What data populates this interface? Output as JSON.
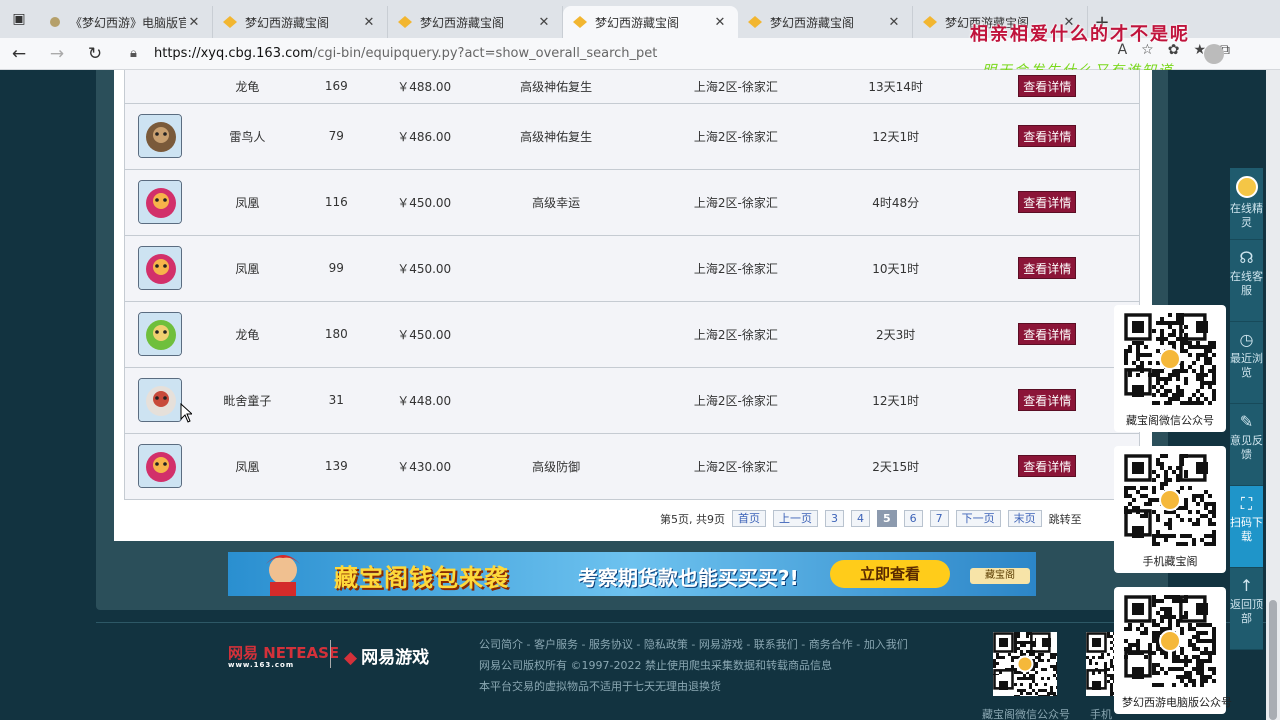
{
  "browser": {
    "tabs": [
      {
        "title": "《梦幻西游》电脑版官方",
        "active": false
      },
      {
        "title": "梦幻西游藏宝阁",
        "active": false
      },
      {
        "title": "梦幻西游藏宝阁",
        "active": false
      },
      {
        "title": "梦幻西游藏宝阁",
        "active": true
      },
      {
        "title": "梦幻西游藏宝阁",
        "active": false
      },
      {
        "title": "梦幻西游藏宝阁",
        "active": false
      }
    ],
    "url_domain": "https://xyq.cbg.163.com",
    "url_path": "/cgi-bin/equipquery.py?act=show_overall_search_pet",
    "close_glyph": "✕",
    "new_tab_glyph": "+"
  },
  "overlay": {
    "line1": "相亲相爱什么的才不是呢",
    "line2": "明天会发生什么又有谁知道"
  },
  "table": {
    "rows": [
      {
        "name": "龙龟",
        "level": "169",
        "price": "￥488.00",
        "skill": "高级神佑复生",
        "server": "上海2区-徐家汇",
        "time": "13天14时",
        "button": "查看详情"
      },
      {
        "name": "雷鸟人",
        "level": "79",
        "price": "￥486.00",
        "skill": "高级神佑复生",
        "server": "上海2区-徐家汇",
        "time": "12天1时",
        "button": "查看详情"
      },
      {
        "name": "凤凰",
        "level": "116",
        "price": "￥450.00",
        "skill": "高级幸运",
        "server": "上海2区-徐家汇",
        "time": "4时48分",
        "button": "查看详情"
      },
      {
        "name": "凤凰",
        "level": "99",
        "price": "￥450.00",
        "skill": "",
        "server": "上海2区-徐家汇",
        "time": "10天1时",
        "button": "查看详情"
      },
      {
        "name": "龙龟",
        "level": "180",
        "price": "￥450.00",
        "skill": "",
        "server": "上海2区-徐家汇",
        "time": "2天3时",
        "button": "查看详情"
      },
      {
        "name": "毗舍童子",
        "level": "31",
        "price": "￥448.00",
        "skill": "",
        "server": "上海2区-徐家汇",
        "time": "12天1时",
        "button": "查看详情"
      },
      {
        "name": "凤凰",
        "level": "139",
        "price": "￥430.00",
        "skill": "高级防御",
        "server": "上海2区-徐家汇",
        "time": "2天15时",
        "button": "查看详情"
      }
    ]
  },
  "pager": {
    "summary": "第5页, 共9页",
    "first": "首页",
    "prev": "上一页",
    "pages": [
      "3",
      "4",
      "5",
      "6",
      "7"
    ],
    "current": "5",
    "next": "下一页",
    "last": "末页",
    "jump": "跳转至"
  },
  "banner": {
    "headline": "藏宝阁钱包来袭",
    "sub": "考察期货款也能买买买?!",
    "cta": "立即查看",
    "logo": "藏宝阁"
  },
  "footer": {
    "netease_logo": "网易 NETEASE",
    "netease_url": "www.163.com",
    "games_logo": "网易游戏",
    "links": "公司简介 - 客户服务 - 服务协议 - 隐私政策 - 网易游戏 - 联系我们 - 商务合作 - 加入我们",
    "copyright": "网易公司版权所有 ©1997-2022  禁止使用爬虫采集数据和转载商品信息",
    "notice": "本平台交易的虚拟物品不适用于七天无理由退换货",
    "qr_labels": [
      "藏宝阁微信公众号",
      "手机"
    ]
  },
  "sidebar": {
    "items": [
      {
        "label": "在线精灵"
      },
      {
        "label": "在线客服"
      },
      {
        "label": "最近浏览"
      },
      {
        "label": "意见反馈"
      },
      {
        "label": "扫码下载"
      },
      {
        "label": "返回顶部"
      }
    ],
    "qr_cards": [
      "藏宝阁微信公众号",
      "手机藏宝阁",
      "梦幻西游电脑版公众号"
    ]
  },
  "colors": {
    "detail_button": "#8b1538",
    "price": "#2a1fd8",
    "sidebar_active": "#1f95c9"
  }
}
